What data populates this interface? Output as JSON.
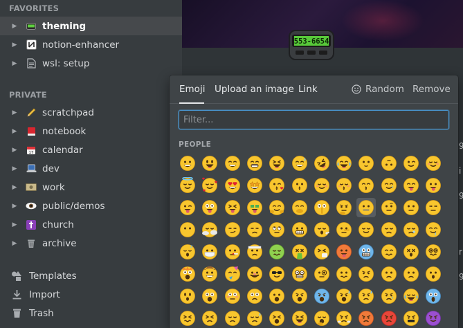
{
  "sidebar": {
    "favorites_label": "FAVORITES",
    "private_label": "PRIVATE",
    "favorites": [
      {
        "label": "theming",
        "icon": "pager-icon",
        "active": true
      },
      {
        "label": "notion-enhancer",
        "icon": "notion-logo-icon"
      },
      {
        "label": "wsl: setup",
        "icon": "page-icon"
      }
    ],
    "private": [
      {
        "label": "scratchpad",
        "icon": "pencil-icon"
      },
      {
        "label": "notebook",
        "icon": "red-book-icon"
      },
      {
        "label": "calendar",
        "icon": "calendar-icon"
      },
      {
        "label": "dev",
        "icon": "laptop-icon"
      },
      {
        "label": "work",
        "icon": "money-icon"
      },
      {
        "label": "public/demos",
        "icon": "eye-icon"
      },
      {
        "label": "church",
        "icon": "cross-icon"
      },
      {
        "label": "archive",
        "icon": "trash-can-icon"
      }
    ],
    "utilities": [
      {
        "label": "Templates",
        "icon": "shapes-icon"
      },
      {
        "label": "Import",
        "icon": "download-icon"
      },
      {
        "label": "Trash",
        "icon": "trash-icon"
      }
    ]
  },
  "page": {
    "pager_number": "553-6654"
  },
  "picker": {
    "tabs": [
      "Emoji",
      "Upload an image",
      "Link"
    ],
    "random_label": "Random",
    "remove_label": "Remove",
    "filter_placeholder": "Filter...",
    "category_label": "PEOPLE",
    "emojis": [
      [
        "grinning",
        "grinning-big-eyes",
        "grinning-smiling-eyes",
        "beaming",
        "squinting-laugh",
        "sweat-smile",
        "rofl",
        "tears-of-joy",
        "slight-smile",
        "upside-down",
        "wink",
        "blush"
      ],
      [
        "halo",
        "hearts",
        "heart-eyes",
        "star-struck",
        "kiss-heart",
        "kissing",
        "smiling-face",
        "kissing-closed-eyes",
        "kissing-smiling-eyes",
        "smile-tear",
        "yum",
        "tongue"
      ],
      [
        "winking-tongue",
        "zany",
        "squinting-tongue",
        "money-mouth",
        "hugging",
        "hand-over-mouth",
        "shushing",
        "thinking",
        "zipper",
        "raised-eyebrow",
        "neutral",
        "expressionless"
      ],
      [
        "no-mouth",
        "face-in-clouds",
        "smirk",
        "unamused",
        "eye-roll",
        "grimace",
        "exhaling",
        "lying",
        "relieved",
        "pensive",
        "sleepy",
        "drooling"
      ],
      [
        "sleeping",
        "mask",
        "thermometer",
        "bandage",
        "nauseated",
        "vomiting",
        "sneezing",
        "hot",
        "cold",
        "woozy",
        "dizzy",
        "spiral-eyes"
      ],
      [
        "exploding",
        "cowboy",
        "partying",
        "disguised",
        "sunglasses",
        "nerd",
        "monocle",
        "confused",
        "worried",
        "slight-frown",
        "frowning",
        "open-mouth"
      ],
      [
        "hushed",
        "astonished",
        "flushed",
        "pleading",
        "frowning-open",
        "anguished",
        "fearful",
        "anxious-sweat",
        "sad-relieved",
        "crying",
        "loudly-crying",
        "screaming"
      ],
      [
        "confounded",
        "persevering",
        "disappointed",
        "downcast-sweat",
        "weary",
        "tired",
        "yawning",
        "steam-nose",
        "pouting",
        "angry",
        "cursing",
        "devil"
      ]
    ]
  }
}
